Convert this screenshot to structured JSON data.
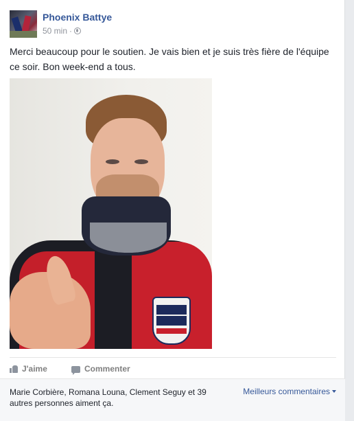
{
  "post": {
    "author": "Phoenix Battye",
    "time": "50 min",
    "separator": "·",
    "privacy_icon": "globe-icon",
    "text": "Merci beaucoup pour le soutien. Je vais bien et je suis très fière de l'équipe ce soir. Bon week-end a tous."
  },
  "actions": {
    "like_label": "J'aime",
    "like_icon": "thumbs-up-icon",
    "comment_label": "Commenter",
    "comment_icon": "comment-icon"
  },
  "footer": {
    "likers_text": "Marie Corbière, Romana Louna, Clement Seguy et 39 autres personnes aiment ça.",
    "sort_label": "Meilleurs commentaires"
  },
  "colors": {
    "link": "#365899",
    "muted": "#90949c",
    "background": "#e9ebee"
  }
}
